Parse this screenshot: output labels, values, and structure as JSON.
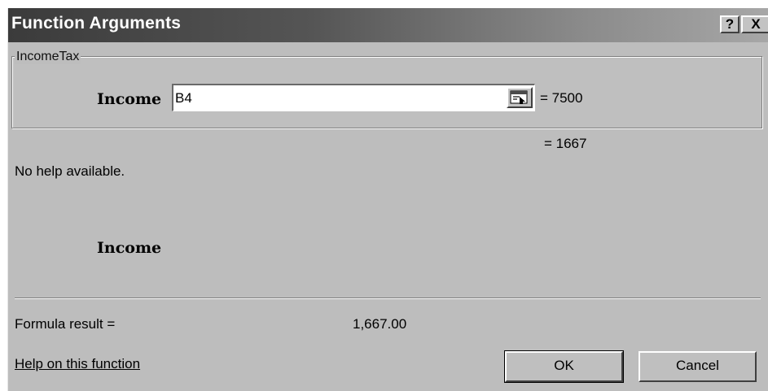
{
  "window": {
    "title": "Function Arguments",
    "help_button": "?",
    "close_button": "X"
  },
  "function_group": {
    "name": "IncomeTax",
    "argument_label": "Income",
    "argument_value": "B4",
    "argument_evaluated": "= 7500",
    "function_evaluated": "= 1667"
  },
  "description": {
    "help_text": "No help available.",
    "argument_name": "Income"
  },
  "result": {
    "label": "Formula result =",
    "value": "1,667.00"
  },
  "footer": {
    "help_link": "Help on this function",
    "ok_label": "OK",
    "cancel_label": "Cancel"
  },
  "icons": {
    "collapse_dialog": "collapse-dialog-icon"
  },
  "colors": {
    "dialog_bg": "#bdbdbd",
    "title_gradient_start": "#3b3b3b",
    "title_gradient_end": "#a7a7a7"
  }
}
